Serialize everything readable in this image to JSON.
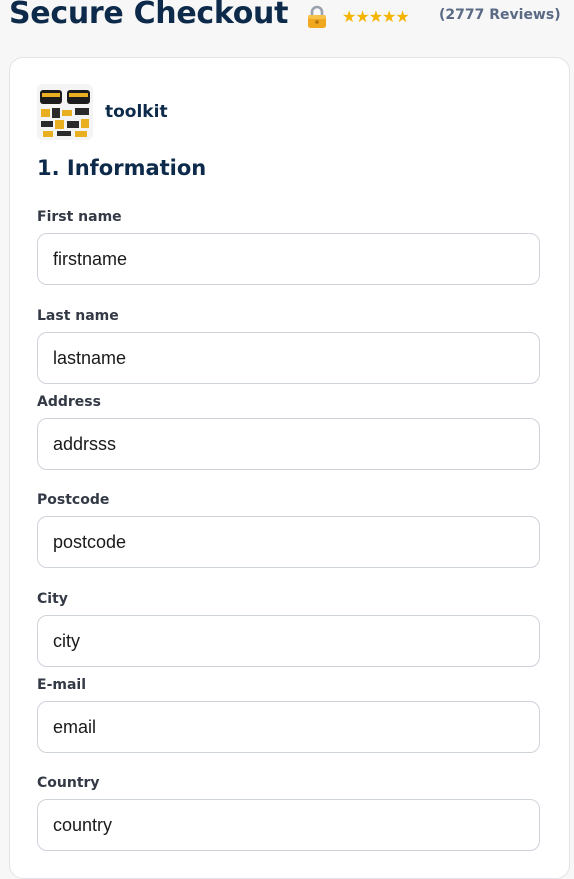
{
  "header": {
    "title": "Secure Checkout",
    "stars": "★★★★★",
    "reviews": "(2777 Reviews)"
  },
  "product": {
    "name": "toolkit",
    "thumbnail_icon": "toolkit-product-image"
  },
  "form": {
    "section_title": "1. Information",
    "fields": [
      {
        "label": "First name",
        "placeholder": "firstname",
        "value": ""
      },
      {
        "label": "Last name",
        "placeholder": "lastname",
        "value": ""
      },
      {
        "label": "Address",
        "placeholder": "addrsss",
        "value": ""
      },
      {
        "label": "Postcode",
        "placeholder": "postcode",
        "value": ""
      },
      {
        "label": "City",
        "placeholder": "city",
        "value": ""
      },
      {
        "label": "E-mail",
        "placeholder": "email",
        "value": ""
      },
      {
        "label": "Country",
        "placeholder": "country",
        "value": ""
      }
    ]
  },
  "colors": {
    "title": "#0d2a4a",
    "stars": "#f5b400",
    "reviews": "#5a6a85",
    "input_border": "#cfd3da"
  },
  "icons": {
    "lock": "lock-icon",
    "rating": "star-icon"
  }
}
